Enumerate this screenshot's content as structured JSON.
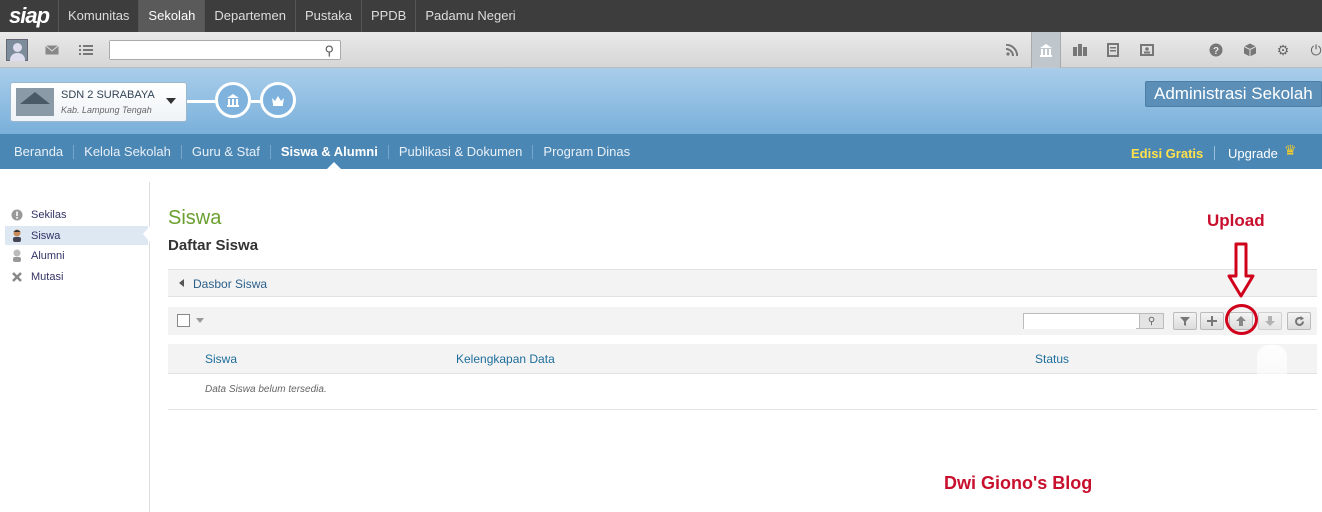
{
  "topbar": {
    "logo": "siap",
    "nav": [
      "Komunitas",
      "Sekolah",
      "Departemen",
      "Pustaka",
      "PPDB",
      "Padamu Negeri"
    ],
    "active": "Sekolah"
  },
  "toolbar": {
    "search_placeholder": "",
    "icons": [
      "user-avatar",
      "mail-icon",
      "list-icon",
      "rss-icon",
      "school-icon",
      "building-icon",
      "book-icon",
      "id-card-icon",
      "help-icon",
      "cube-icon",
      "gear-icon",
      "power-icon"
    ]
  },
  "school": {
    "name": "SDN 2 SURABAYA",
    "region": "Kab. Lampung Tengah"
  },
  "admin_button": "Administrasi Sekolah",
  "mainnav": {
    "items": [
      "Beranda",
      "Kelola Sekolah",
      "Guru & Staf",
      "Siswa & Alumni",
      "Publikasi & Dokumen",
      "Program Dinas"
    ],
    "active": "Siswa & Alumni",
    "edisi": "Edisi Gratis",
    "upgrade": "Upgrade"
  },
  "sidebar": {
    "items": [
      {
        "label": "Sekilas",
        "icon": "info-icon"
      },
      {
        "label": "Siswa",
        "icon": "student-icon"
      },
      {
        "label": "Alumni",
        "icon": "alumni-icon"
      },
      {
        "label": "Mutasi",
        "icon": "cross-icon"
      }
    ],
    "active": "Siswa"
  },
  "content": {
    "title": "Siswa",
    "subtitle": "Daftar Siswa",
    "dasbor_link": "Dasbor Siswa",
    "table": {
      "columns": [
        "Siswa",
        "Kelengkapan Data",
        "Status"
      ],
      "empty_message": "Data Siswa belum tersedia."
    },
    "grid_buttons": [
      "filter",
      "add",
      "upload",
      "download",
      "refresh"
    ]
  },
  "annotations": {
    "upload": "Upload",
    "blog": "Dwi Giono's Blog"
  },
  "colors": {
    "topbar": "#3d3d3d",
    "nav_blue": "#4b87b5",
    "title_green": "#6a9f2f",
    "annotation_red": "#c8102e"
  }
}
